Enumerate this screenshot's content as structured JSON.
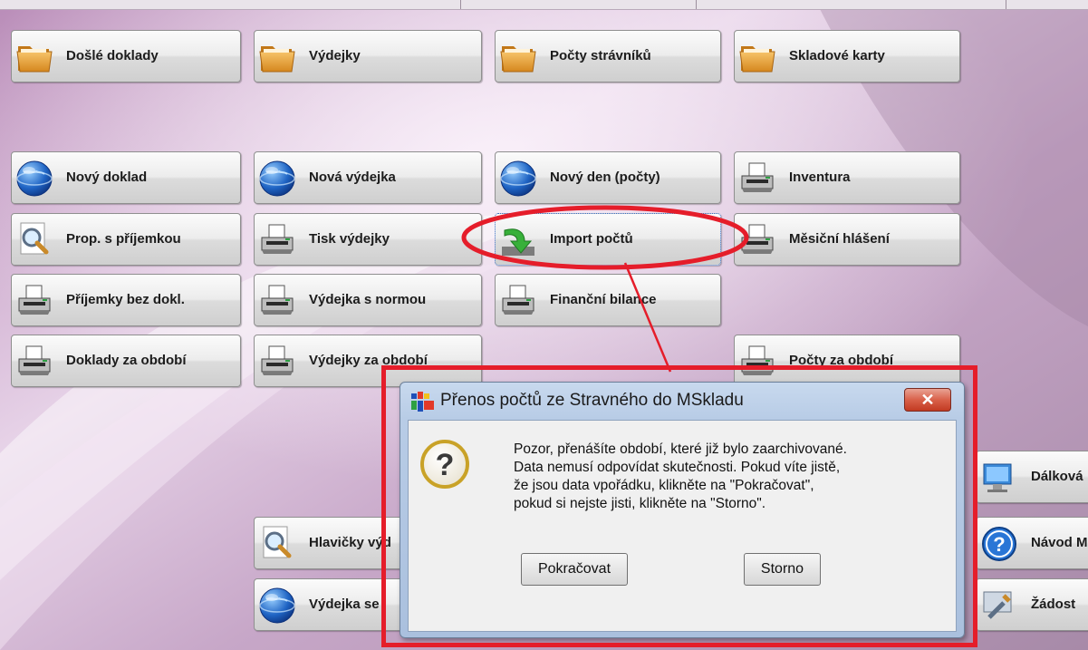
{
  "colors": {
    "annotation": "#e51d2a",
    "dialog_title_bg": "#b8cce6",
    "close_button": "#c23a22"
  },
  "tiles": [
    {
      "label": "Došlé doklady",
      "icon": "folder-icon"
    },
    {
      "label": "Výdejky",
      "icon": "folder-icon"
    },
    {
      "label": "Počty strávníků",
      "icon": "folder-icon"
    },
    {
      "label": "Skladové karty",
      "icon": "folder-icon"
    },
    {
      "label": "Nový doklad",
      "icon": "globe-icon"
    },
    {
      "label": "Nová výdejka",
      "icon": "globe-icon"
    },
    {
      "label": "Nový den (počty)",
      "icon": "globe-icon"
    },
    {
      "label": "Inventura",
      "icon": "printer-icon"
    },
    {
      "label": "Prop. s příjemkou",
      "icon": "magnifier-icon"
    },
    {
      "label": "Tisk výdejky",
      "icon": "printer-icon"
    },
    {
      "label": "Import počtů",
      "icon": "green-arrow-icon"
    },
    {
      "label": "Měsiční hlášení",
      "icon": "printer-icon"
    },
    {
      "label": "Příjemky bez dokl.",
      "icon": "printer-icon"
    },
    {
      "label": "Výdejka s normou",
      "icon": "printer-icon"
    },
    {
      "label": "Finanční bilance",
      "icon": "printer-icon"
    },
    {
      "label": "Doklady za období",
      "icon": "printer-icon"
    },
    {
      "label": "Výdejky za období",
      "icon": "printer-icon"
    },
    {
      "label": "Počty za období",
      "icon": "printer-icon"
    },
    {
      "label": "Hlavičky výd",
      "icon": "magnifier-icon"
    },
    {
      "label": "Výdejka se",
      "icon": "globe-icon"
    },
    {
      "label": "Dálková",
      "icon": "computer-icon"
    },
    {
      "label": "Návod M",
      "icon": "help-icon"
    },
    {
      "label": "Žádost",
      "icon": "tools-icon"
    }
  ],
  "dialog": {
    "title": "Přenos počtů ze Stravného do MSkladu",
    "close_label": "✕",
    "message_lines": [
      "Pozor, přenášíte období, které již bylo zaarchivované.",
      "Data nemusí odpovídat skutečnosti. Pokud víte jistě,",
      "že jsou data vpořádku, klikněte na \"Pokračovat\",",
      "pokud si nejste jisti, klikněte na \"Storno\"."
    ],
    "continue_label": "Pokračovat",
    "cancel_label": "Storno"
  }
}
